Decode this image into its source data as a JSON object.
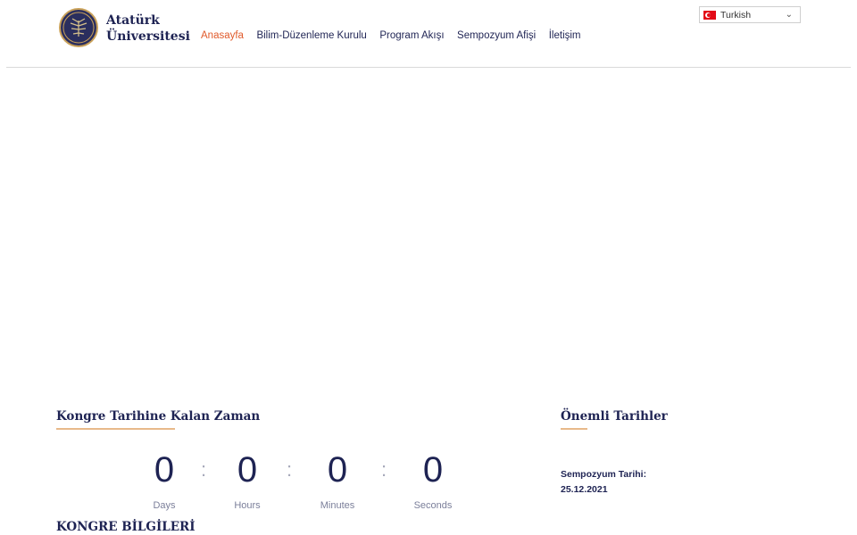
{
  "logo": {
    "line1": "Atatürk",
    "line2": "Üniversitesi"
  },
  "nav": {
    "items": [
      {
        "label": "Anasayfa",
        "active": true
      },
      {
        "label": "Bilim-Düzenleme Kurulu"
      },
      {
        "label": "Program Akışı"
      },
      {
        "label": "Sempozyum Afişi"
      },
      {
        "label": "İletişim"
      }
    ]
  },
  "language": {
    "selected": "Turkish"
  },
  "countdown": {
    "title": "Kongre Tarihine Kalan Zaman",
    "units": [
      {
        "value": "0",
        "label": "Days"
      },
      {
        "value": "0",
        "label": "Hours"
      },
      {
        "value": "0",
        "label": "Minutes"
      },
      {
        "value": "0",
        "label": "Seconds"
      }
    ],
    "separator": ":"
  },
  "important_dates": {
    "title": "Önemli Tarihler",
    "label": "Sempozyum Tarihi:",
    "date": "25.12.2021"
  },
  "congress_info": {
    "title": "KONGRE BİLGİLERİ"
  },
  "colors": {
    "accent": "#e05a2b",
    "navy": "#1e2353",
    "underline": "#e8b98a"
  }
}
